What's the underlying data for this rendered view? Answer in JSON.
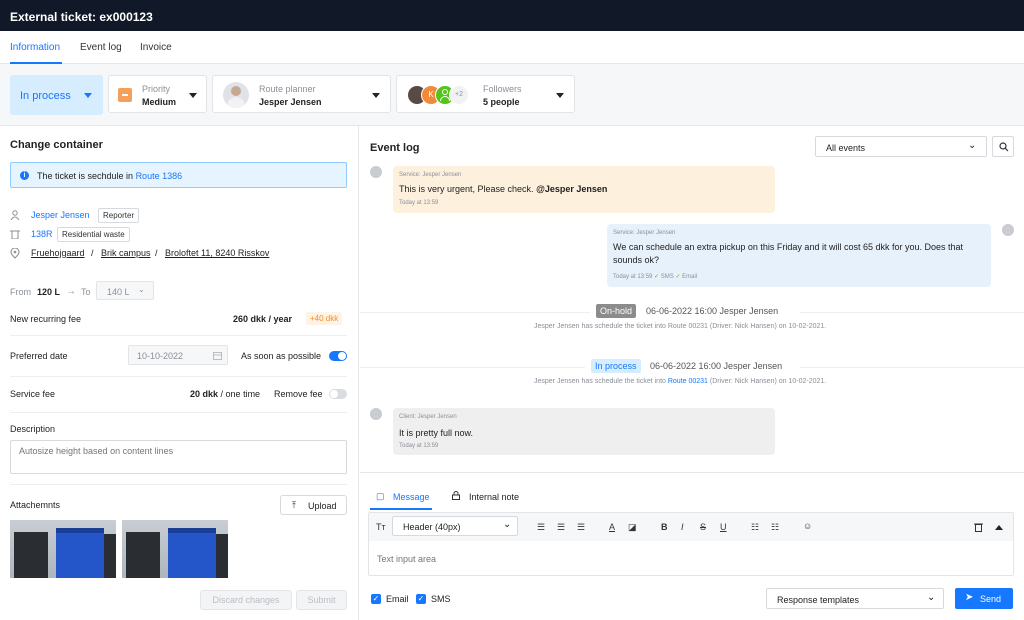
{
  "header": {
    "title": "External ticket: ex000123"
  },
  "tabs": [
    {
      "label": "Information",
      "active": true
    },
    {
      "label": "Event log"
    },
    {
      "label": "Invoice"
    }
  ],
  "status": {
    "state": "In process",
    "priority_label": "Priority",
    "priority_value": "Medium",
    "planner_label": "Route planner",
    "planner_value": "Jesper Jensen",
    "followers_label": "Followers",
    "followers_value": "5 people",
    "avatar_k": "K",
    "avatar_more": "+2"
  },
  "left": {
    "title": "Change container",
    "notice_text": "The ticket is sechdule in ",
    "notice_link": "Route 1386",
    "reporter_name": "Jesper Jensen",
    "reporter_tag": "Reporter",
    "container_id": "138R",
    "container_tag": "Residential waste",
    "addr_1": "Fruehojgaard",
    "addr_sep": "/",
    "addr_2": "Brik campus",
    "addr_3": "Broloftet 11, 8240 Risskov",
    "from_label": "From",
    "from_value": "120 L",
    "to_label": "To",
    "to_value": "140 L",
    "recurring_label": "New recurring fee",
    "recurring_value": "260 dkk / year",
    "recurring_diff": "+40 dkk",
    "pref_label": "Preferred date",
    "pref_date": "10-10-2022",
    "asap_label": "As soon as possible",
    "service_label": "Service fee",
    "service_amount": "20 dkk",
    "service_unit": "/ one time",
    "remove_label": "Remove fee",
    "desc_label": "Description",
    "desc_placeholder": "Autosize height based on content lines",
    "attach_label": "Attachemnts",
    "upload_label": "Upload",
    "discard_label": "Discard changes",
    "submit_label": "Submit"
  },
  "eventlog": {
    "title": "Event log",
    "filter": "All events",
    "m1_who": "Service: Jesper Jensen",
    "m1_text": "This is very urgent, Please check. ",
    "m1_mention": "@Jesper Jensen",
    "m1_time": "Today at 13:59",
    "m2_who": "Service: Jesper Jensen",
    "m2_text": "We can schedule an extra pickup on this Friday and it will cost 65 dkk for you. Does that sounds ok?",
    "m2_time": "Today at 13:59",
    "m2_sms": "SMS",
    "m2_email": "Email",
    "e1_badge": "On-hold",
    "e1_meta": "06-06-2022 16:00 Jesper Jensen",
    "e1_detail": "Jesper Jensen has schedule the ticket into Route 00231 (Driver: Nick Hansen) on 10-02-2021.",
    "e2_badge": "In process",
    "e2_meta": "06-06-2022 16:00 Jesper Jensen",
    "e2_detail_a": "Jesper Jensen has schedule the ticket into ",
    "e2_detail_link": "Route 00231",
    "e2_detail_b": " (Driver: Nick Hansen) on 10-02-2021.",
    "m3_who": "Client: Jesper Jensen",
    "m3_text": "It is pretty full now.",
    "m3_time": "Today at 13:59"
  },
  "composer": {
    "tab_message": "Message",
    "tab_note": "Internal note",
    "header_select": "Header (40px)",
    "placeholder": "Text input area",
    "email_label": "Email",
    "sms_label": "SMS",
    "templates": "Response templates",
    "send": "Send"
  },
  "colors": {
    "accent": "#1677ff",
    "topbar": "#111827",
    "onhold": "#8c8c8c",
    "inprocess_bg": "#d6ecff"
  }
}
